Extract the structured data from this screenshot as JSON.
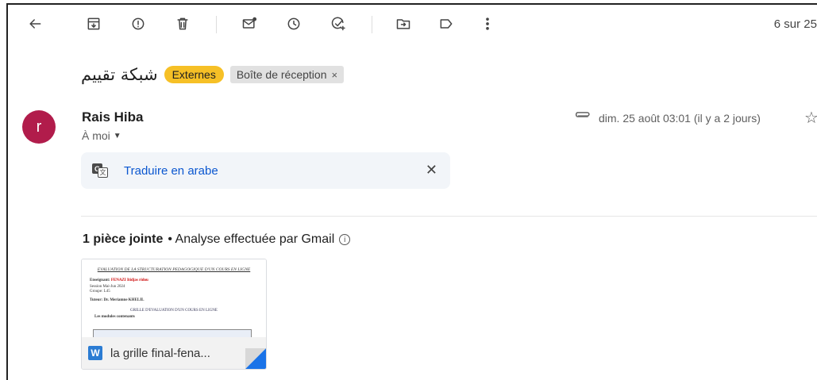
{
  "toolbar": {
    "counter": "6 sur 25"
  },
  "message": {
    "subject": "شبكة تقييم",
    "labels": {
      "external": "Externes",
      "inbox": "Boîte de réception",
      "inbox_remove": "×"
    },
    "sender": {
      "avatar_letter": "r",
      "avatar_color": "#b11c4b",
      "name": "Rais Hiba",
      "to": "À moi"
    },
    "date": "dim. 25 août 03:01 (il y a 2 jours)"
  },
  "translate": {
    "label": "Traduire en arabe",
    "close": "✕"
  },
  "attachments": {
    "count_label": "1 pièce jointe",
    "scan_label": "• Analyse effectuée par Gmail",
    "file": {
      "name": "la grille final-fena...",
      "type_letter": "W",
      "preview": {
        "title": "EVALUATION DE LA STRUCTURATION PEDAGOGIQUE D'UN COURS EN LIGNE",
        "teacher_label": "Enseignant:",
        "teacher_name": "FENAZI Itidjas ridou",
        "session": "Session Mai-Jun 2024",
        "group": "Groupe: L45",
        "tutor": "Tuteur: Dr. Meriamne KHELIL",
        "grid_title": "GRILLE D'EVALUATION D'UN COURS EN LIGNE",
        "section": "Les modules contenants"
      }
    }
  },
  "colors": {
    "accent_blue": "#0b57d0",
    "label_yellow": "#f6c026",
    "word_blue": "#2b7cd3"
  }
}
